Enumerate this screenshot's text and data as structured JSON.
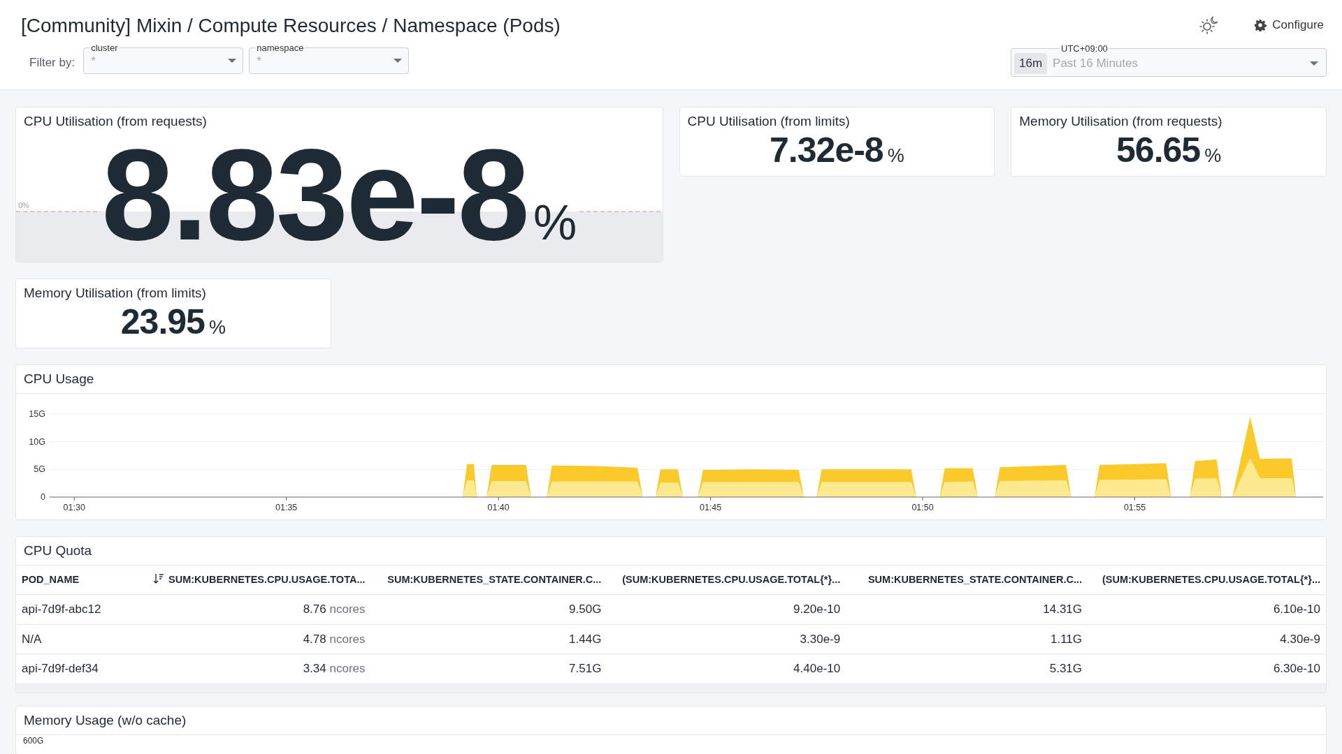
{
  "header": {
    "title": "[Community] Mixin / Compute Resources / Namespace (Pods)",
    "filter_label": "Filter by:",
    "filters": [
      {
        "label": "cluster",
        "value": "*"
      },
      {
        "label": "namespace",
        "value": "*"
      }
    ],
    "configure": "Configure",
    "time_picker": {
      "zone": "UTC+09:00",
      "badge": "16m",
      "range": "Past 16 Minutes"
    }
  },
  "stats": [
    {
      "title": "CPU Utilisation (from requests)",
      "value": "8.83e-8",
      "unit": "%",
      "kind": "large",
      "threshold_label": "0%"
    },
    {
      "title": "CPU Utilisation (from limits)",
      "value": "7.32e-8",
      "unit": "%",
      "kind": "small"
    },
    {
      "title": "Memory Utilisation (from requests)",
      "value": "56.65",
      "unit": "%",
      "kind": "small"
    },
    {
      "title": "Memory Utilisation (from limits)",
      "value": "23.95",
      "unit": "%",
      "kind": "small"
    }
  ],
  "cpu_usage": {
    "title": "CPU Usage",
    "chart_data": {
      "type": "area",
      "stacked": true,
      "grid": true,
      "x": [
        99.16,
        99.26,
        99.42,
        99.49,
        99.6,
        99.72,
        99.84,
        100.65,
        100.77,
        100.95,
        101.14,
        101.26,
        102.3,
        103.28,
        103.4,
        103.55,
        103.7,
        103.82,
        104.23,
        104.35,
        104.5,
        104.7,
        104.82,
        106.0,
        107.08,
        107.2,
        107.35,
        107.5,
        107.62,
        109.73,
        109.85,
        110.1,
        110.4,
        110.52,
        111.18,
        111.3,
        111.5,
        111.7,
        111.82,
        113.38,
        113.5,
        113.8,
        114.05,
        114.17,
        115.74,
        115.86,
        116.1,
        116.3,
        116.42,
        116.93,
        117.05,
        117.2,
        117.3,
        117.72,
        117.95,
        118.7,
        118.8
      ],
      "series": [
        {
          "color": "#fde98f",
          "values": [
            0,
            3.0,
            3.0,
            0,
            null,
            0,
            2.9,
            2.9,
            0,
            null,
            0,
            2.8,
            2.8,
            2.8,
            0,
            null,
            0,
            2.6,
            2.6,
            0,
            null,
            0,
            2.7,
            2.7,
            2.7,
            0,
            null,
            0,
            2.7,
            2.7,
            0,
            null,
            0,
            2.7,
            2.8,
            0,
            null,
            0,
            2.9,
            3.0,
            0,
            null,
            0,
            3.1,
            3.2,
            0,
            null,
            0,
            3.3,
            3.4,
            0,
            null,
            0,
            7.0,
            3.4,
            3.4,
            0
          ]
        },
        {
          "color": "#fbc92a",
          "values": [
            0,
            3.0,
            3.0,
            0,
            null,
            0,
            2.9,
            2.9,
            0,
            null,
            0,
            2.9,
            2.8,
            2.5,
            0,
            null,
            0,
            2.4,
            2.4,
            0,
            null,
            0,
            2.2,
            2.3,
            2.2,
            0,
            null,
            0,
            2.3,
            2.3,
            0,
            null,
            0,
            2.5,
            2.4,
            0,
            null,
            0,
            2.5,
            2.8,
            0,
            null,
            0,
            2.7,
            2.9,
            0,
            null,
            0,
            3.2,
            3.4,
            0,
            null,
            0,
            7.5,
            3.5,
            3.6,
            0
          ]
        }
      ],
      "xlim": [
        89.42,
        119.44
      ],
      "ylim": [
        0,
        15
      ],
      "xticks": [
        {
          "value": 90,
          "label": "01:30"
        },
        {
          "value": 95,
          "label": "01:35"
        },
        {
          "value": 100,
          "label": "01:40"
        },
        {
          "value": 105,
          "label": "01:45"
        },
        {
          "value": 110,
          "label": "01:50"
        },
        {
          "value": 115,
          "label": "01:55"
        }
      ],
      "yticks": [
        {
          "value": 0,
          "label": "0"
        },
        {
          "value": 5,
          "label": "5G"
        },
        {
          "value": 10,
          "label": "10G"
        },
        {
          "value": 15,
          "label": "15G"
        }
      ]
    }
  },
  "cpu_quota": {
    "title": "CPU Quota",
    "columns": [
      {
        "label": "POD_NAME",
        "sorted": false
      },
      {
        "label": "SUM:KUBERNETES.CPU.USAGE.TOTA...",
        "sorted": true
      },
      {
        "label": "SUM:KUBERNETES_STATE.CONTAINER.C...",
        "sorted": false
      },
      {
        "label": "(SUM:KUBERNETES.CPU.USAGE.TOTAL{*}...",
        "sorted": false
      },
      {
        "label": "SUM:KUBERNETES_STATE.CONTAINER.C...",
        "sorted": false
      },
      {
        "label": "(SUM:KUBERNETES.CPU.USAGE.TOTAL{*}...",
        "sorted": false
      }
    ],
    "rows": [
      {
        "cells": [
          {
            "value": "api-7d9f-abc12"
          },
          {
            "value": "8.76",
            "unit": "ncores"
          },
          {
            "value": "9.50G"
          },
          {
            "value": "9.20e-10"
          },
          {
            "value": "14.31G"
          },
          {
            "value": "6.10e-10"
          }
        ]
      },
      {
        "cells": [
          {
            "value": "N/A"
          },
          {
            "value": "4.78",
            "unit": "ncores"
          },
          {
            "value": "1.44G"
          },
          {
            "value": "3.30e-9"
          },
          {
            "value": "1.11G"
          },
          {
            "value": "4.30e-9"
          }
        ]
      },
      {
        "cells": [
          {
            "value": "api-7d9f-def34"
          },
          {
            "value": "3.34",
            "unit": "ncores"
          },
          {
            "value": "7.51G"
          },
          {
            "value": "4.40e-10"
          },
          {
            "value": "5.31G"
          },
          {
            "value": "6.30e-10"
          }
        ]
      }
    ]
  },
  "memory_usage": {
    "title": "Memory Usage (w/o cache)",
    "y_tick_labels": [
      "600G"
    ]
  }
}
